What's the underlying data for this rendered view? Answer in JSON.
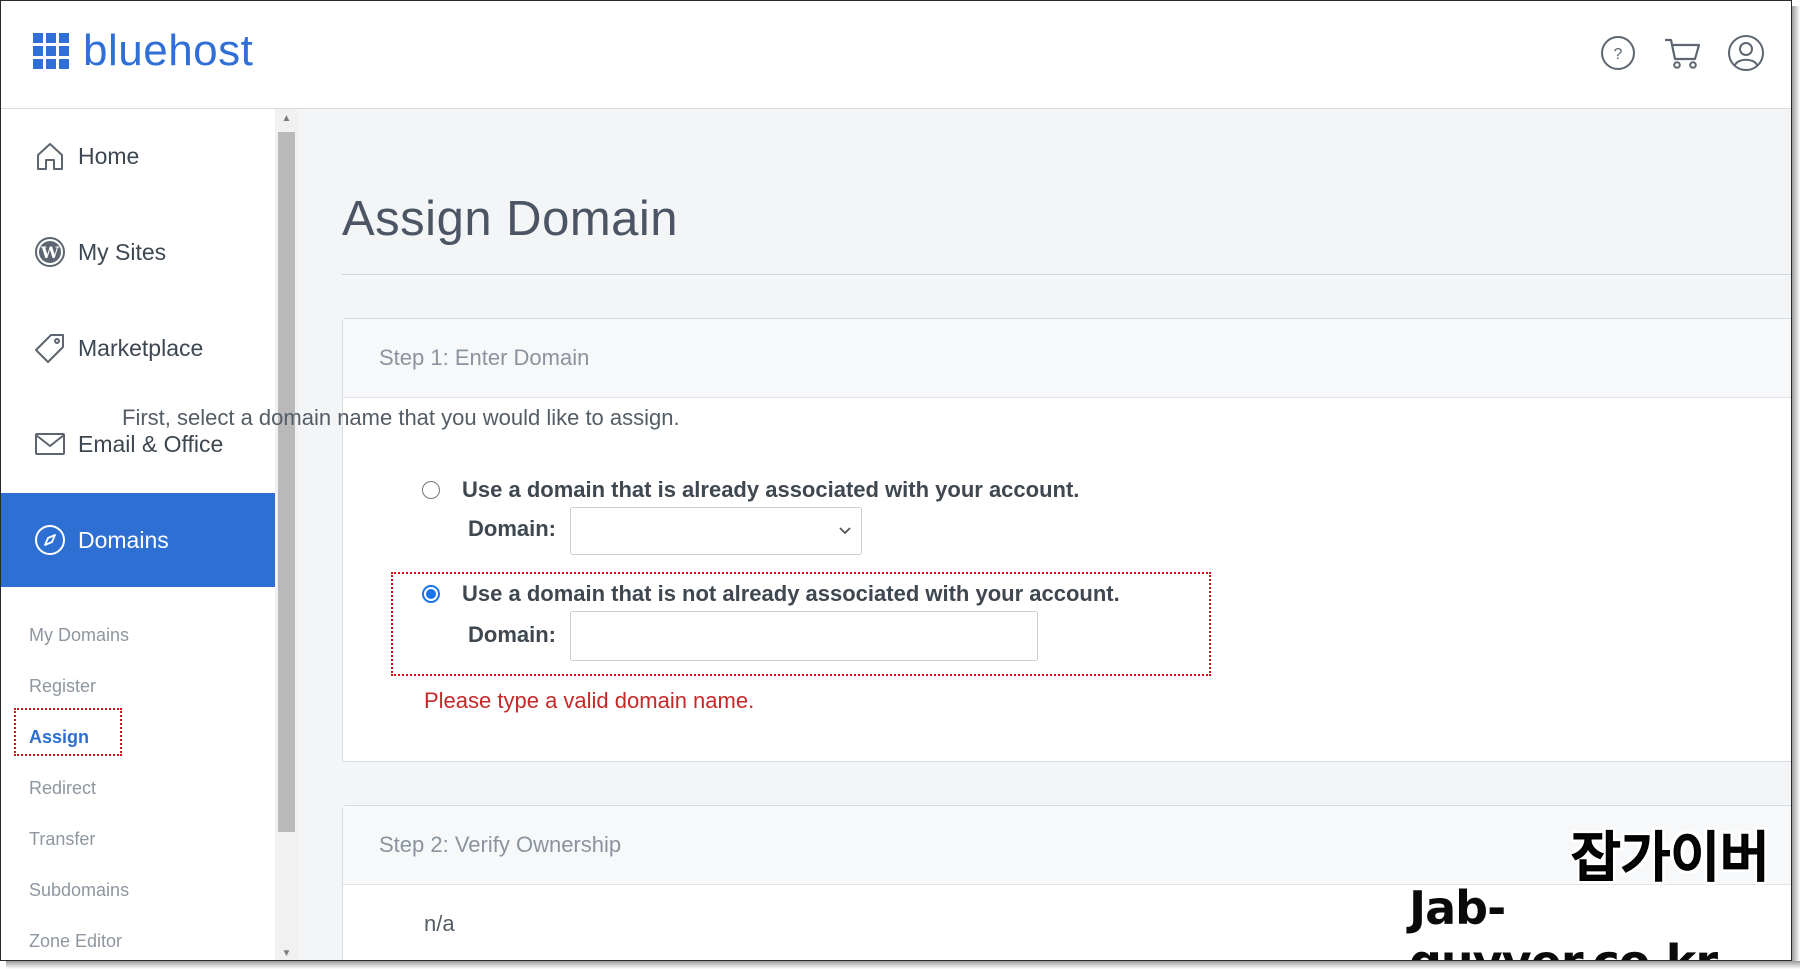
{
  "brand": {
    "name": "bluehost",
    "color": "#2f6fd6"
  },
  "header": {
    "icons": [
      "help-icon",
      "cart-icon",
      "account-icon"
    ]
  },
  "sidebar": {
    "items": [
      {
        "label": "Home",
        "icon": "home-icon"
      },
      {
        "label": "My Sites",
        "icon": "wordpress-icon"
      },
      {
        "label": "Marketplace",
        "icon": "tag-icon"
      },
      {
        "label": "Email & Office",
        "icon": "mail-icon"
      },
      {
        "label": "Domains",
        "icon": "compass-icon",
        "active": true
      }
    ],
    "subitems": [
      "My Domains",
      "Register",
      "Assign",
      "Redirect",
      "Transfer",
      "Subdomains",
      "Zone Editor"
    ],
    "current_subitem": "Assign"
  },
  "main": {
    "title": "Assign Domain",
    "step1": {
      "heading": "Step 1: Enter Domain",
      "intro": "First, select a domain name that you would like to assign.",
      "option_existing": "Use a domain that is already associated with your account.",
      "option_new": "Use a domain that is not already associated with your account.",
      "domain_label": "Domain:",
      "selected_option": "option_new",
      "domain_select_value": "",
      "domain_input_value": "",
      "error": "Please type a valid domain name."
    },
    "step2": {
      "heading": "Step 2: Verify Ownership",
      "value": "n/a"
    }
  },
  "watermark": {
    "line1": "잡가이버",
    "line2": "Jab-guyver.co.kr"
  },
  "colors": {
    "accent": "#2e6fd4",
    "error": "#c62828",
    "highlight": "#d01414"
  }
}
